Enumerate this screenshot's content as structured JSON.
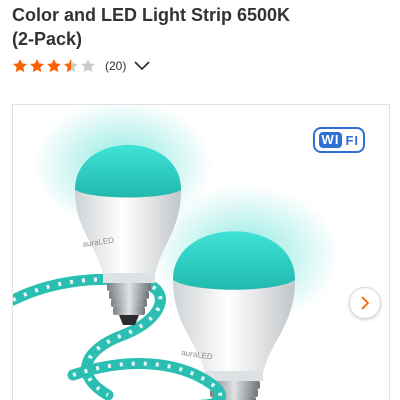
{
  "product": {
    "title_line1": "Color and LED Light Strip 6500K",
    "title_line2": "(2-Pack)"
  },
  "rating": {
    "stars": 3.5,
    "max_stars": 5,
    "review_count": "(20)",
    "star_color": "#f96302",
    "empty_star_color": "#cccccc"
  },
  "badge": {
    "wifi_part1": "WI",
    "wifi_part2": "FI",
    "color": "#2f6fd6"
  },
  "image": {
    "brand_text": "auraLED",
    "icons": {
      "next": "chevron-right-icon",
      "expand": "chevron-down-icon"
    },
    "accent_color": "#f96302",
    "glow_color": "#2fd6c8"
  }
}
